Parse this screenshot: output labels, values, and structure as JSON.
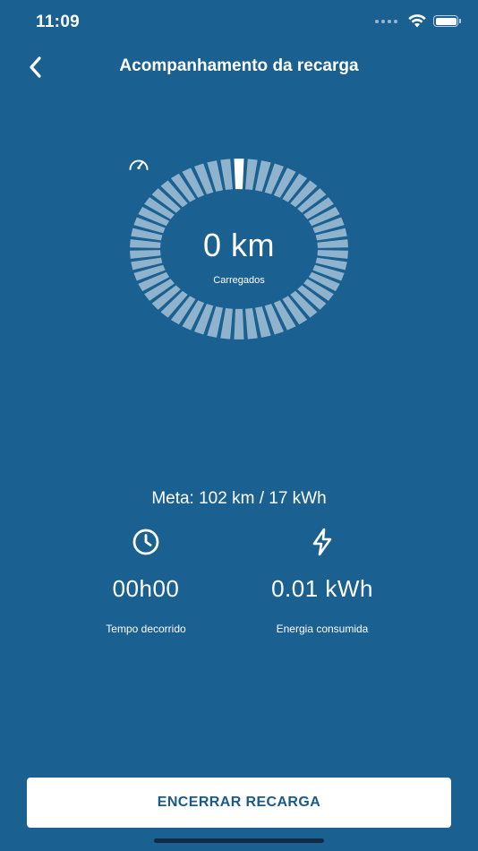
{
  "status_bar": {
    "time": "11:09"
  },
  "nav": {
    "title": "Acompanhamento da recarga",
    "back_icon": "chevron-left-icon"
  },
  "gauge": {
    "value": "0 km",
    "label": "Carregados",
    "icon": "speedometer-icon",
    "progress_fraction": 0.0,
    "segment_count": 50,
    "colors": {
      "segment": "#8fb3cc",
      "indicator": "#ffffff"
    }
  },
  "meta": {
    "text": "Meta: 102 km / 17 kWh"
  },
  "stats": {
    "time": {
      "icon": "clock-icon",
      "value": "00h00",
      "label": "Tempo decorrido"
    },
    "energy": {
      "icon": "lightning-icon",
      "value": "0.01 kWh",
      "label": "Energia consumida"
    }
  },
  "actions": {
    "end_button_label": "ENCERRAR RECARGA"
  },
  "colors": {
    "background": "#1a6091",
    "button_text": "#1a5a8a"
  }
}
